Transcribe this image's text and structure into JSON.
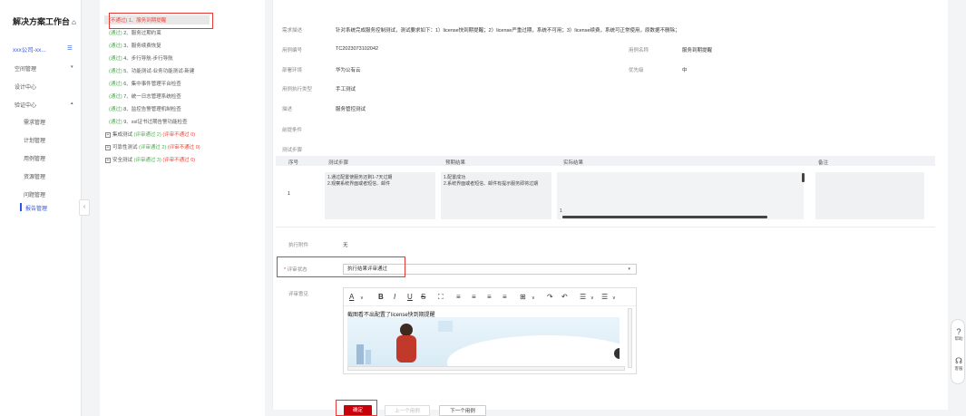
{
  "sidebar": {
    "brand": "解决方案工作台",
    "company": "xxx公司-xx...",
    "nav": [
      {
        "label": "空间管理",
        "expand": "▾"
      },
      {
        "label": "设计中心",
        "expand": ""
      },
      {
        "label": "验证中心",
        "expand": "▴"
      }
    ],
    "sub_items": [
      "需求管理",
      "计划管理",
      "用例管理",
      "资源管理",
      "问题管理",
      "报告管理"
    ],
    "active_sub": "报告管理",
    "collapse_glyph": "‹"
  },
  "tree": {
    "items": [
      {
        "status": "(不通过)",
        "status_kind": "fail",
        "label": "1、服务到期提醒"
      },
      {
        "status": "(通过)",
        "status_kind": "ok",
        "label": "2、服务过期约束"
      },
      {
        "status": "(通过)",
        "status_kind": "ok",
        "label": "3、服务续费恢复"
      },
      {
        "status": "(通过)",
        "status_kind": "ok",
        "label": "4、步行导航-步行导航"
      },
      {
        "status": "(通过)",
        "status_kind": "ok",
        "label": "5、功能测试-业务功能测试-新建"
      },
      {
        "status": "(通过)",
        "status_kind": "ok",
        "label": "6、集中事件管理平台检查"
      },
      {
        "status": "(通过)",
        "status_kind": "ok",
        "label": "7、统一日志管理系统检查"
      },
      {
        "status": "(通过)",
        "status_kind": "ok",
        "label": "8、监控告警管理机制检查"
      },
      {
        "status": "(通过)",
        "status_kind": "ok",
        "label": "9、ssl证书过期告警功能检查"
      }
    ],
    "groups": [
      {
        "name": "集成测试",
        "pass": "(评审通过 2)",
        "fail": "(评审不通过 0)"
      },
      {
        "name": "可靠性测试",
        "pass": "(评审通过 2)",
        "fail": "(评审不通过 0)"
      },
      {
        "name": "安全测试",
        "pass": "(评审通过 3)",
        "fail": "(评审不通过 0)"
      }
    ]
  },
  "detail": {
    "req_label": "需求描述",
    "req_value": "针对系统完成服务控制测试，测试要求如下：1）license快到期提醒；2）license严重过期，系统不可用；3）license续费，系统可正常使用，原数据不删除；",
    "case_no_label": "用例编号",
    "case_no": "TC2023073102042",
    "case_name_label": "用例名称",
    "case_name": "服务到期提醒",
    "env_label": "部署环境",
    "env": "华为公有云",
    "priority_label": "优先级",
    "priority": "中",
    "exec_type_label": "用例执行类型",
    "exec_type": "手工测试",
    "desc_label": "描述",
    "desc": "服务管控测试",
    "precondition_label": "前提条件",
    "steps_label": "测试步骤",
    "table_headers": [
      "序号",
      "测试步骤",
      "预期结果",
      "实际结果",
      "备注"
    ],
    "row": {
      "no": "1",
      "step": "1.通过配置使服务还剩1-7天过期\n2.观察系统界面或者短信、邮件",
      "expected": "1.配置成功\n2.系统界面或者短信、邮件有提示服务即将过期",
      "actual": "1",
      "remark": ""
    },
    "attach_label": "执行附件",
    "attach": "无",
    "review_status_label": "评审状态",
    "review_status": "执行结果评审通过",
    "review_opinion_label": "评审意见",
    "editor_text": "截图看不出配置了license快到期提醒",
    "toolbar": [
      "A",
      "∨",
      "B",
      "I",
      "U",
      "S",
      "⛶",
      "≡",
      "≡",
      "≡",
      "≡",
      "⊞",
      "∨",
      "↷",
      "↶",
      "☰",
      "∨",
      "☰",
      "∨"
    ],
    "buttons": {
      "confirm": "确定",
      "prev": "上一个用例",
      "next": "下一个用例"
    }
  },
  "float": {
    "help": "帮助",
    "service": "客服"
  },
  "colors": {
    "accent": "#2f54eb",
    "primary_btn": "#c7000b",
    "pass": "#4caf50",
    "fail": "#f44336"
  }
}
